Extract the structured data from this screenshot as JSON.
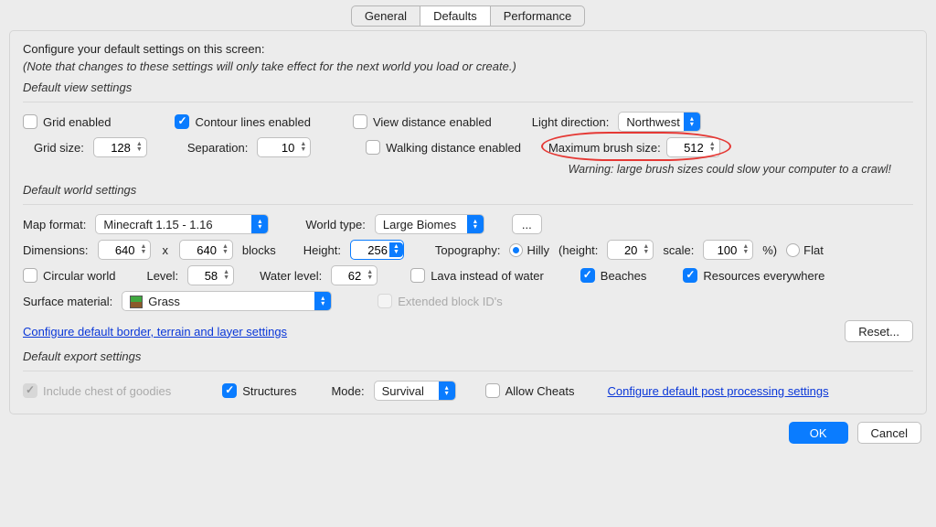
{
  "tabs": {
    "general": "General",
    "defaults": "Defaults",
    "performance": "Performance"
  },
  "intro": {
    "line1": "Configure your default settings on this screen:",
    "note": "(Note that changes to these settings will only take effect for the next world you load or create.)"
  },
  "view": {
    "title": "Default view settings",
    "gridEnabled": "Grid enabled",
    "contour": "Contour lines enabled",
    "viewDist": "View distance enabled",
    "lightDir": "Light direction:",
    "lightDirVal": "Northwest",
    "gridSize": "Grid size:",
    "gridSizeVal": "128",
    "separation": "Separation:",
    "separationVal": "10",
    "walkDist": "Walking distance enabled",
    "maxBrush": "Maximum brush size:",
    "maxBrushVal": "512",
    "warn": "Warning: large brush sizes could slow your computer to a crawl!"
  },
  "world": {
    "title": "Default world settings",
    "mapFormat": "Map format:",
    "mapFormatVal": "Minecraft 1.15 - 1.16",
    "worldType": "World type:",
    "worldTypeVal": "Large Biomes",
    "more": "...",
    "dimensions": "Dimensions:",
    "dimW": "640",
    "dimH": "640",
    "blocks": "blocks",
    "height": "Height:",
    "heightVal": "256",
    "topo": "Topography:",
    "hilly": "Hilly",
    "heightParen": "(height:",
    "heightNum": "20",
    "scale": "scale:",
    "scaleNum": "100",
    "pct": "%)",
    "flat": "Flat",
    "circular": "Circular world",
    "level": "Level:",
    "levelVal": "58",
    "waterLevel": "Water level:",
    "waterLevelVal": "62",
    "lava": "Lava instead of water",
    "beaches": "Beaches",
    "resources": "Resources everywhere",
    "surface": "Surface material:",
    "surfaceVal": "Grass",
    "extended": "Extended block ID's",
    "configLink": "Configure default border, terrain and layer settings",
    "reset": "Reset..."
  },
  "export": {
    "title": "Default export settings",
    "goodies": "Include chest of goodies",
    "structures": "Structures",
    "mode": "Mode:",
    "modeVal": "Survival",
    "cheats": "Allow Cheats",
    "configLink": "Configure default post processing settings"
  },
  "footer": {
    "ok": "OK",
    "cancel": "Cancel"
  }
}
